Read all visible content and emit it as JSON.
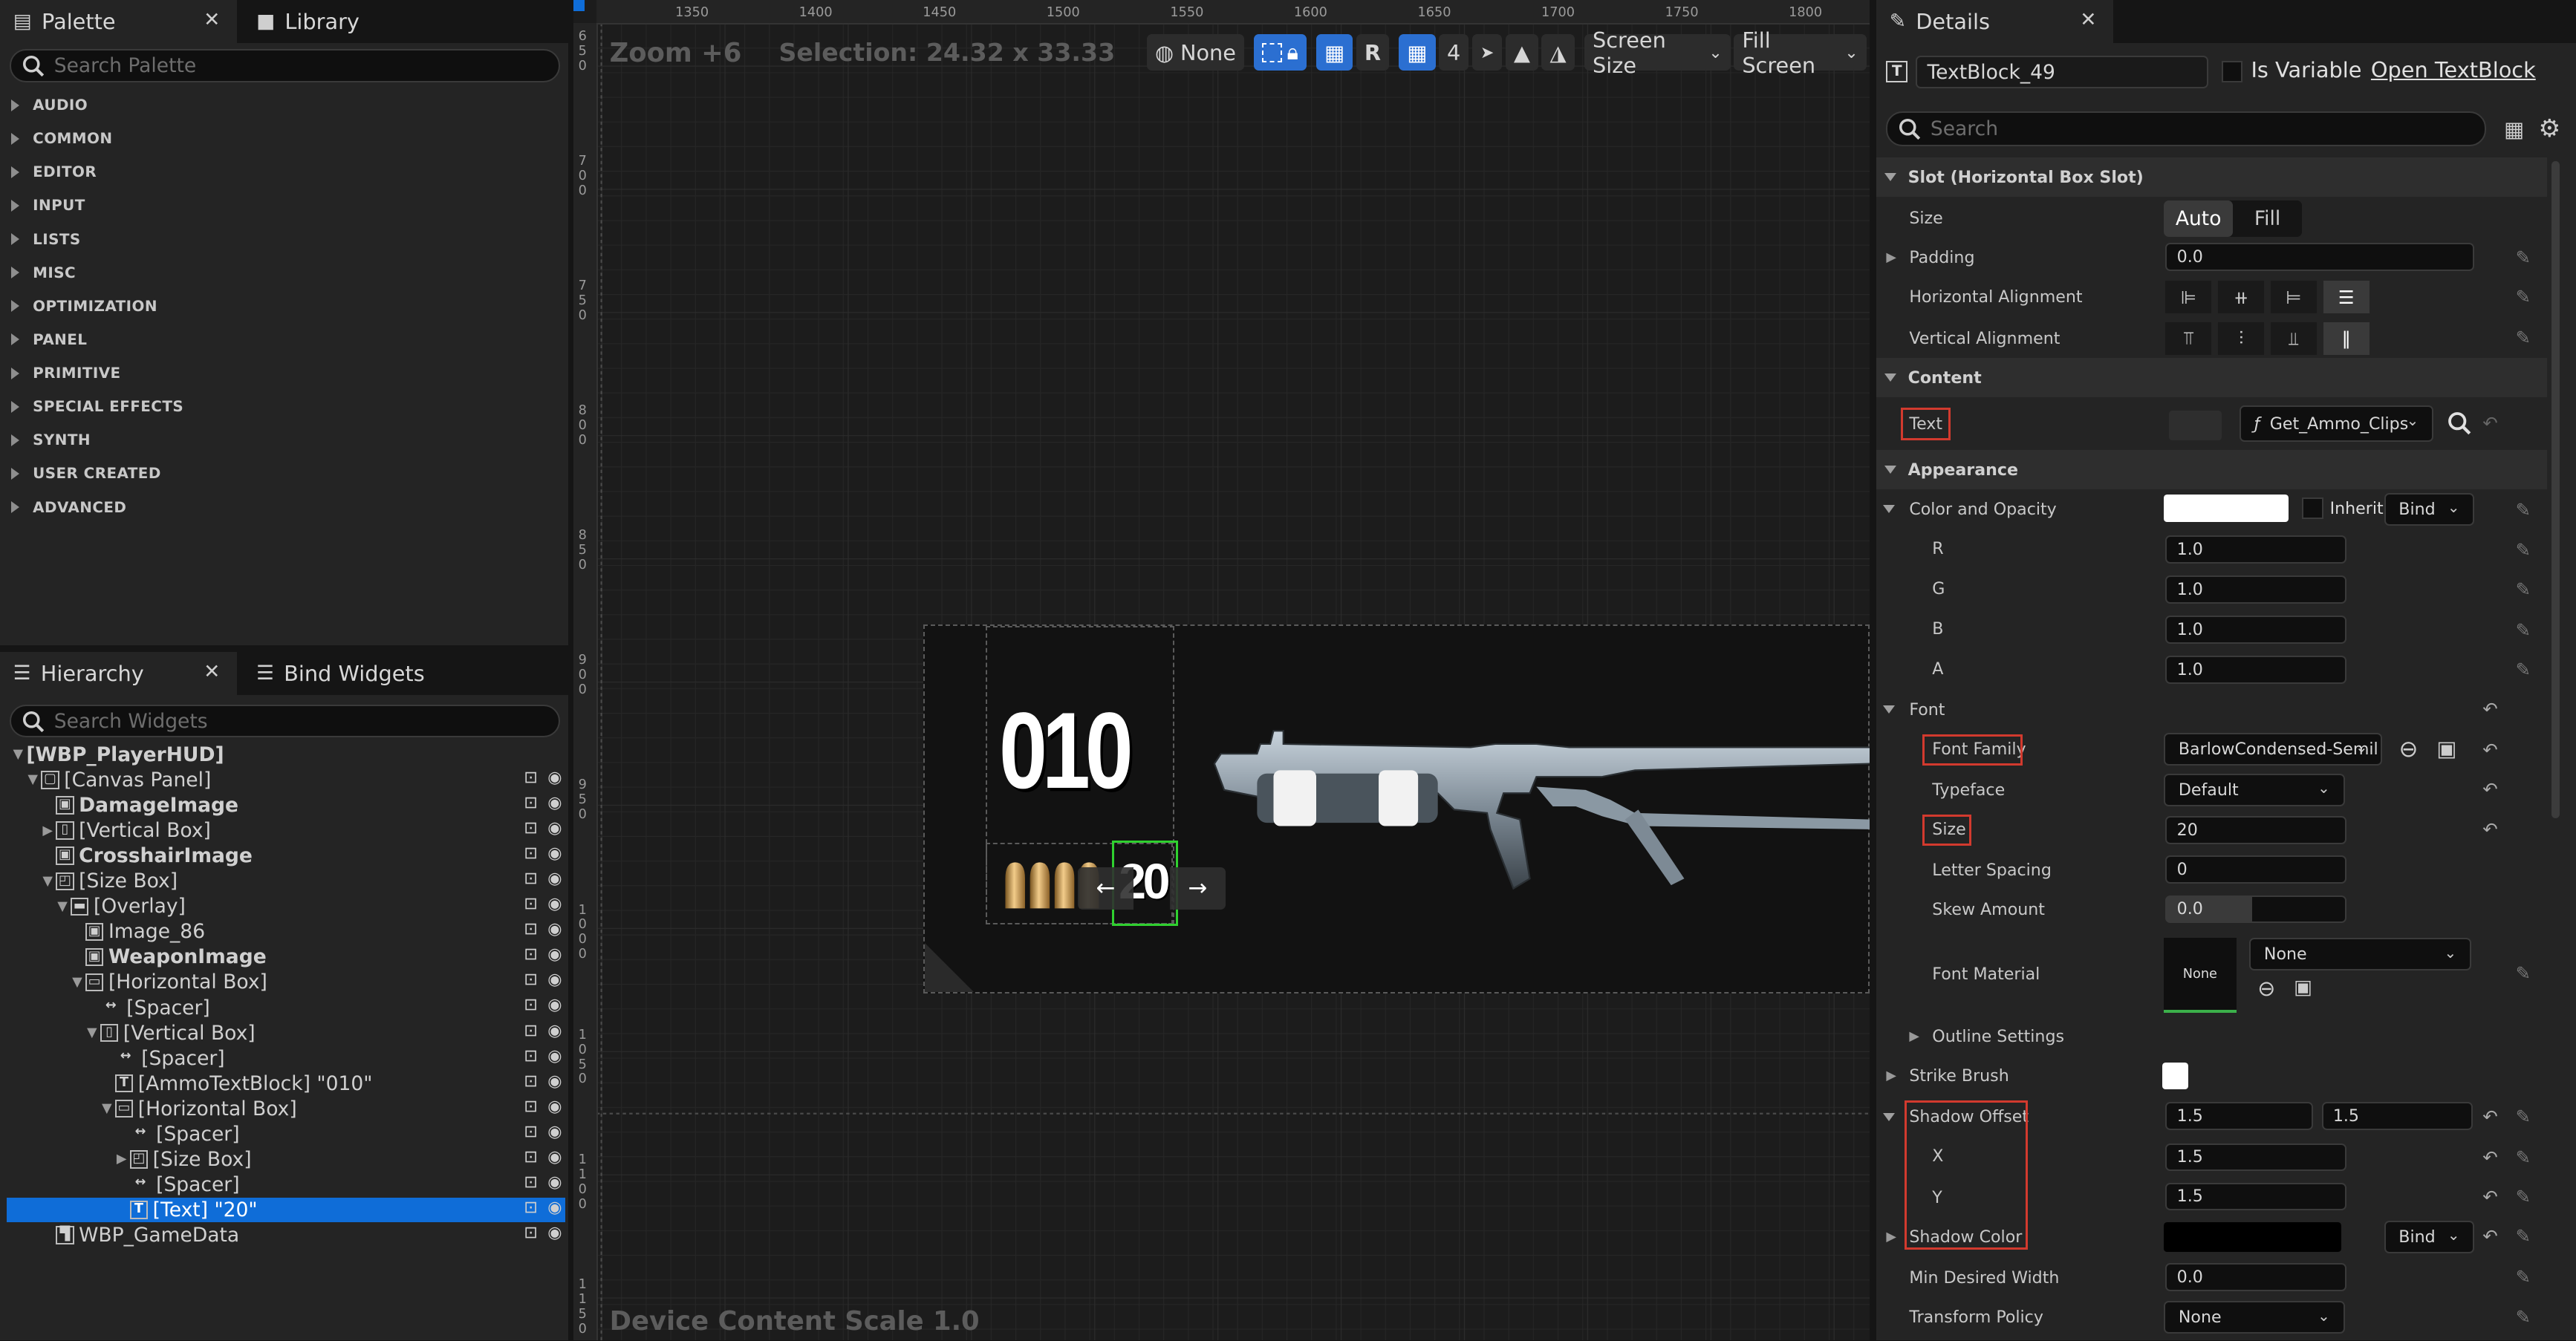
{
  "palette": {
    "tab_label": "Palette",
    "library_label": "Library",
    "search_placeholder": "Search Palette",
    "categories": [
      "AUDIO",
      "COMMON",
      "EDITOR",
      "INPUT",
      "LISTS",
      "MISC",
      "OPTIMIZATION",
      "PANEL",
      "PRIMITIVE",
      "SPECIAL EFFECTS",
      "SYNTH",
      "USER CREATED",
      "ADVANCED"
    ]
  },
  "hierarchy": {
    "tab_label": "Hierarchy",
    "bind_label": "Bind Widgets",
    "search_placeholder": "Search Widgets",
    "rows": [
      {
        "label": "[WBP_PlayerHUD]",
        "indent": 0,
        "exp": "▼",
        "bold": true,
        "icon": ""
      },
      {
        "label": "[Canvas Panel]",
        "indent": 1,
        "exp": "▼",
        "bold": false,
        "icon": "canvas-icon"
      },
      {
        "label": "DamageImage",
        "indent": 2,
        "exp": "",
        "bold": true,
        "icon": "image-icon"
      },
      {
        "label": "[Vertical Box]",
        "indent": 2,
        "exp": "▶",
        "bold": false,
        "icon": "vbox-icon"
      },
      {
        "label": "CrosshairImage",
        "indent": 2,
        "exp": "",
        "bold": true,
        "icon": "image-icon"
      },
      {
        "label": "[Size Box]",
        "indent": 2,
        "exp": "▼",
        "bold": false,
        "icon": "sizebox-icon"
      },
      {
        "label": "[Overlay]",
        "indent": 3,
        "exp": "▼",
        "bold": false,
        "icon": "overlay-icon"
      },
      {
        "label": "Image_86",
        "indent": 4,
        "exp": "",
        "bold": false,
        "icon": "image-icon"
      },
      {
        "label": "WeaponImage",
        "indent": 4,
        "exp": "",
        "bold": true,
        "icon": "image-icon"
      },
      {
        "label": "[Horizontal Box]",
        "indent": 4,
        "exp": "▼",
        "bold": false,
        "icon": "hbox-icon"
      },
      {
        "label": "[Spacer]",
        "indent": 5,
        "exp": "",
        "bold": false,
        "icon": "spacer-icon"
      },
      {
        "label": "[Vertical Box]",
        "indent": 5,
        "exp": "▼",
        "bold": false,
        "icon": "vbox-icon"
      },
      {
        "label": "[Spacer]",
        "indent": 6,
        "exp": "",
        "bold": false,
        "icon": "spacer-icon"
      },
      {
        "label": "[AmmoTextBlock] \"010\"",
        "indent": 6,
        "exp": "",
        "bold": false,
        "icon": "text-icon"
      },
      {
        "label": "[Horizontal Box]",
        "indent": 6,
        "exp": "▼",
        "bold": false,
        "icon": "hbox-icon"
      },
      {
        "label": "[Spacer]",
        "indent": 7,
        "exp": "",
        "bold": false,
        "icon": "spacer-icon"
      },
      {
        "label": "[Size Box]",
        "indent": 7,
        "exp": "▶",
        "bold": false,
        "icon": "sizebox-icon"
      },
      {
        "label": "[Spacer]",
        "indent": 7,
        "exp": "",
        "bold": false,
        "icon": "spacer-icon"
      },
      {
        "label": "[Text] \"20\"",
        "indent": 7,
        "exp": "",
        "bold": false,
        "icon": "text-icon",
        "selected": true
      },
      {
        "label": "WBP_GameData",
        "indent": 2,
        "exp": "",
        "bold": false,
        "icon": "userwidget-icon"
      }
    ]
  },
  "viewport": {
    "zoom": "Zoom +6",
    "selection": "Selection: 24.32 x 33.33",
    "device_scale": "Device Content Scale 1.0",
    "ruler_x": [
      "1350",
      "1400",
      "1450",
      "1500",
      "1550",
      "1600",
      "1650",
      "1700",
      "1750",
      "1800"
    ],
    "ruler_y": [
      "650",
      "700",
      "750",
      "800",
      "850",
      "900",
      "950",
      "1000",
      "1050",
      "1100",
      "1150"
    ],
    "toolbar": {
      "none_label": "None",
      "r_label": "R",
      "grid_value": "4",
      "screen_size": "Screen Size",
      "fill_screen": "Fill Screen"
    },
    "hud": {
      "ammo_text": "010",
      "clip_text": "20",
      "arrow_left": "←",
      "arrow_right": "→"
    }
  },
  "details": {
    "tab_label": "Details",
    "name_value": "TextBlock_49",
    "is_variable_label": "Is Variable",
    "open_label": "Open TextBlock",
    "search_placeholder": "Search",
    "slot_section": "Slot (Horizontal Box Slot)",
    "size_label": "Size",
    "size_auto": "Auto",
    "size_fill": "Fill",
    "padding_label": "Padding",
    "padding_value": "0.0",
    "halign_label": "Horizontal Alignment",
    "valign_label": "Vertical Alignment",
    "content_section": "Content",
    "text_label": "Text",
    "text_binding": "Get_Ammo_Clips",
    "appearance_section": "Appearance",
    "color_label": "Color and Opacity",
    "inherit_label": "Inherit",
    "bind_label": "Bind",
    "r_label": "R",
    "r_value": "1.0",
    "g_label": "G",
    "g_value": "1.0",
    "b_label": "B",
    "b_value": "1.0",
    "a_label": "A",
    "a_value": "1.0",
    "font_label": "Font",
    "font_family_label": "Font Family",
    "font_family_value": "BarlowCondensed-Semil",
    "typeface_label": "Typeface",
    "typeface_value": "Default",
    "size2_label": "Size",
    "size2_value": "20",
    "letter_spacing_label": "Letter Spacing",
    "letter_spacing_value": "0",
    "skew_label": "Skew Amount",
    "skew_value": "0.0",
    "font_material_label": "Font Material",
    "font_material_thumb": "None",
    "font_material_value": "None",
    "outline_label": "Outline Settings",
    "strike_label": "Strike Brush",
    "shadow_offset_label": "Shadow Offset",
    "shadow_offset_x": "1.5",
    "shadow_offset_y": "1.5",
    "x_label": "X",
    "x_value": "1.5",
    "y_label": "Y",
    "y_value": "1.5",
    "shadow_color_label": "Shadow Color",
    "shadow_bind": "Bind",
    "min_width_label": "Min Desired Width",
    "min_width_value": "0.0",
    "transform_label": "Transform Policy",
    "transform_value": "None"
  },
  "colors": {
    "accent": "#0f6dd8",
    "highlight": "#d23a2e",
    "selection_green": "#2fd12f"
  }
}
